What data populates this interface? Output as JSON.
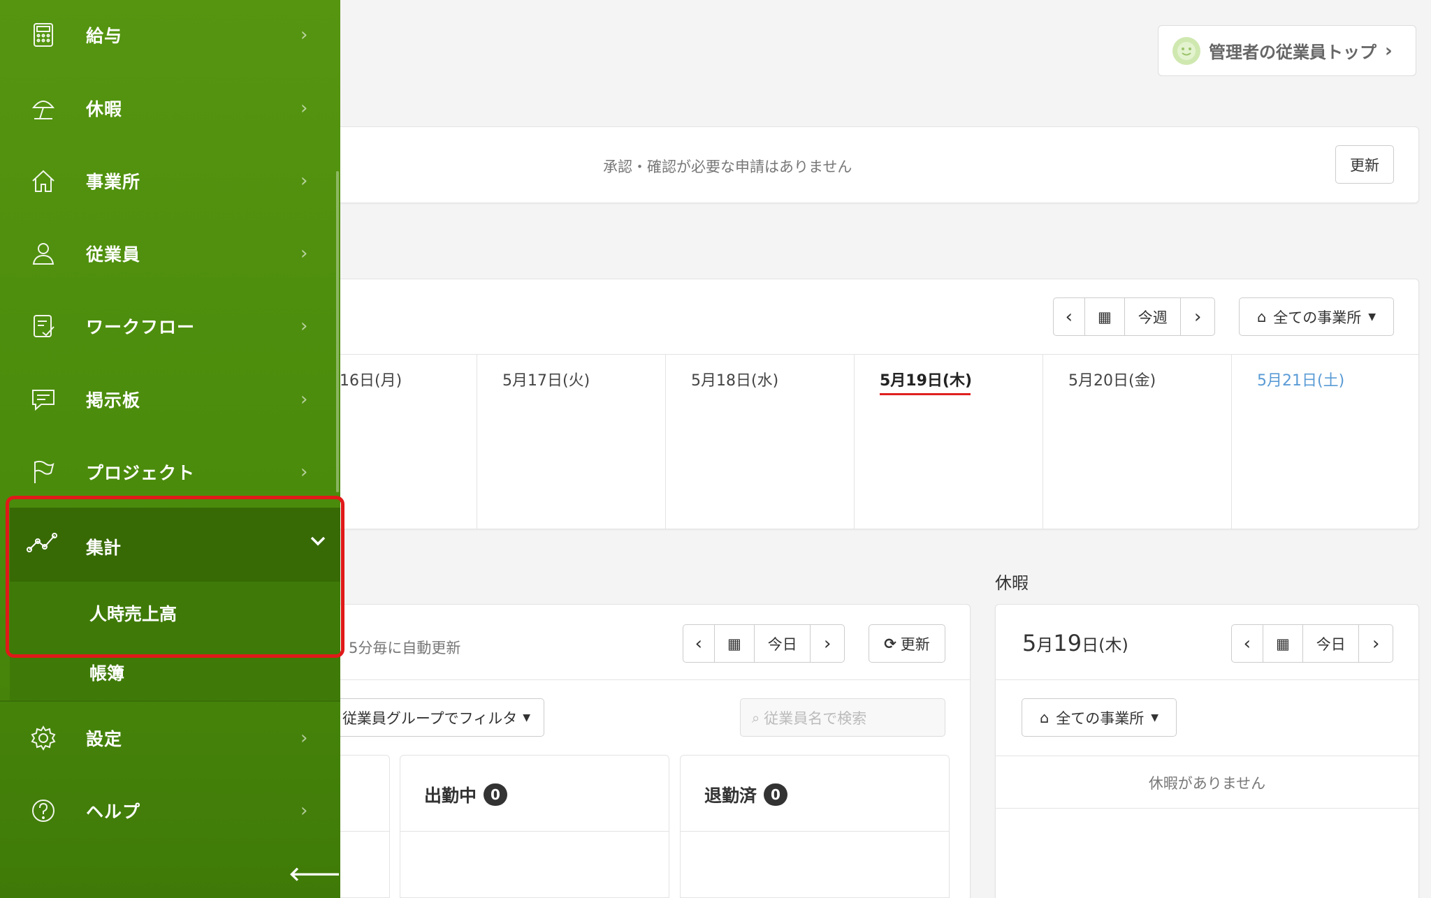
{
  "sidebar": {
    "items": [
      {
        "label": "給与",
        "icon": "calculator-icon"
      },
      {
        "label": "休暇",
        "icon": "beach-umbrella-icon"
      },
      {
        "label": "事業所",
        "icon": "home-icon"
      },
      {
        "label": "従業員",
        "icon": "person-icon"
      },
      {
        "label": "ワークフロー",
        "icon": "checklist-icon"
      },
      {
        "label": "掲示板",
        "icon": "chat-icon"
      },
      {
        "label": "プロジェクト",
        "icon": "flag-icon"
      }
    ],
    "active": {
      "label": "集計",
      "icon": "line-chart-icon"
    },
    "sub_items": [
      "人時売上高",
      "帳簿"
    ],
    "bottom_items": [
      {
        "label": "設定",
        "icon": "gear-icon"
      },
      {
        "label": "ヘルプ",
        "icon": "help-circle-icon"
      }
    ],
    "collapse_glyph": "🡐"
  },
  "header": {
    "admin_top": "管理者の従業員トップ"
  },
  "approvals": {
    "message": "承認・確認が必要な申請はありません",
    "refresh": "更新"
  },
  "week": {
    "nav_prev": "‹",
    "nav_next": "›",
    "this_week": "今週",
    "office_select": "全ての事業所",
    "days": [
      "16日(月)",
      "5月17日(火)",
      "5月18日(水)",
      "5月19日(木)",
      "5月20日(金)",
      "5月21日(土)"
    ]
  },
  "attendance": {
    "auto_update": "5分毎に自動更新",
    "today": "今日",
    "refresh": "更新",
    "group_filter": "従業員グループでフィルタ",
    "search_placeholder": "従業員名で検索",
    "working_label": "出勤中",
    "working_count": "0",
    "left_label": "退勤済",
    "left_count": "0"
  },
  "leave": {
    "section_title": "休暇",
    "date_month": "5",
    "date_m": "月",
    "date_day": "19",
    "date_d": "日",
    "date_weekday": "(木)",
    "today": "今日",
    "office_select": "全ての事業所",
    "empty": "休暇がありません"
  },
  "colors": {
    "sidebar": "#4f8f0e",
    "active": "#376a05",
    "highlight": "#e01919",
    "today_underline": "#e02020",
    "saturday": "#5a9bd5"
  }
}
